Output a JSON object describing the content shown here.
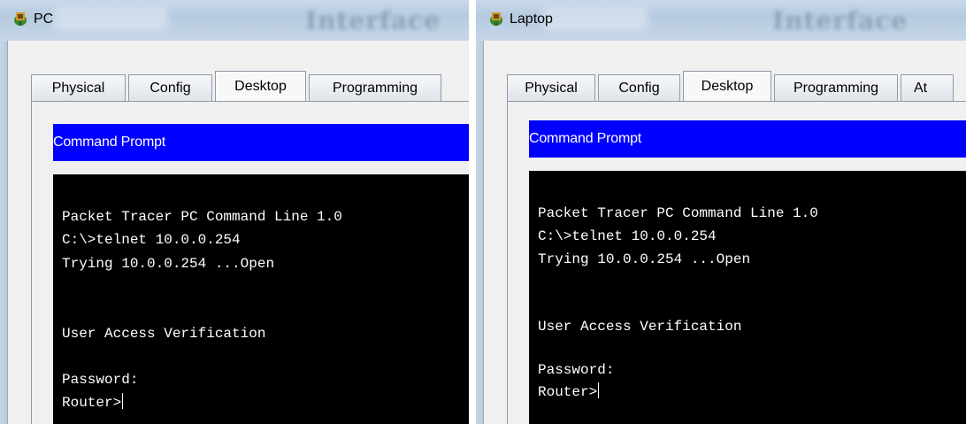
{
  "windows": [
    {
      "title": "PC",
      "tabs": [
        "Physical",
        "Config",
        "Desktop",
        "Programming"
      ],
      "active_tab": "Desktop",
      "panel_header": "Command Prompt",
      "terminal": {
        "lines": [
          "Packet Tracer PC Command Line 1.0",
          "C:\\>telnet 10.0.0.254",
          "Trying 10.0.0.254 ...Open",
          "",
          "",
          "User Access Verification",
          "",
          "Password:",
          "Router>"
        ]
      }
    },
    {
      "title": "Laptop",
      "tabs": [
        "Physical",
        "Config",
        "Desktop",
        "Programming",
        "At"
      ],
      "active_tab": "Desktop",
      "panel_header": "Command Prompt",
      "terminal": {
        "lines": [
          "Packet Tracer PC Command Line 1.0",
          "C:\\>telnet 10.0.0.254",
          "Trying 10.0.0.254 ...Open",
          "",
          "",
          "User Access Verification",
          "",
          "Password:",
          "Router>"
        ]
      }
    }
  ],
  "colors": {
    "header_blue": "#0000ff",
    "terminal_bg": "#000000",
    "terminal_fg": "#ffffff",
    "titlebar": "#c0d2e4"
  },
  "icons": {
    "app": "packet-tracer-device-icon"
  }
}
